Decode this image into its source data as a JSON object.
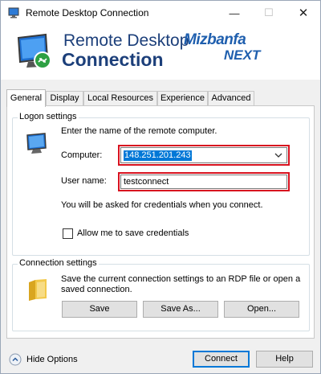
{
  "window": {
    "title": "Remote Desktop Connection",
    "controls": {
      "minimize": "—",
      "maximize": "☐",
      "close": "✕"
    }
  },
  "banner": {
    "line1": "Remote Desktop",
    "line2": "Connection",
    "watermark_line1": "Mizbanfa",
    "watermark_line2": "NEXT"
  },
  "tabs": [
    {
      "label": "General",
      "active": true
    },
    {
      "label": "Display",
      "active": false
    },
    {
      "label": "Local Resources",
      "active": false
    },
    {
      "label": "Experience",
      "active": false
    },
    {
      "label": "Advanced",
      "active": false
    }
  ],
  "logon": {
    "group_title": "Logon settings",
    "prompt": "Enter the name of the remote computer.",
    "computer_label": "Computer:",
    "computer_value": "148.251.201.243",
    "username_label": "User name:",
    "username_value": "testconnect",
    "credentials_note": "You will be asked for credentials when you connect.",
    "save_credentials_label": "Allow me to save credentials",
    "save_credentials_checked": false
  },
  "connection": {
    "group_title": "Connection settings",
    "description_line1": "Save the current connection settings to an RDP file or open a",
    "description_line2": "saved connection.",
    "save_label": "Save",
    "save_as_label": "Save As...",
    "open_label": "Open..."
  },
  "footer": {
    "hide_options_label": "Hide Options",
    "connect_label": "Connect",
    "help_label": "Help"
  },
  "colors": {
    "highlight_box": "#d8121f",
    "selection": "#0078d7",
    "banner_text": "#1c3f7a",
    "watermark": "#1f5fae"
  }
}
